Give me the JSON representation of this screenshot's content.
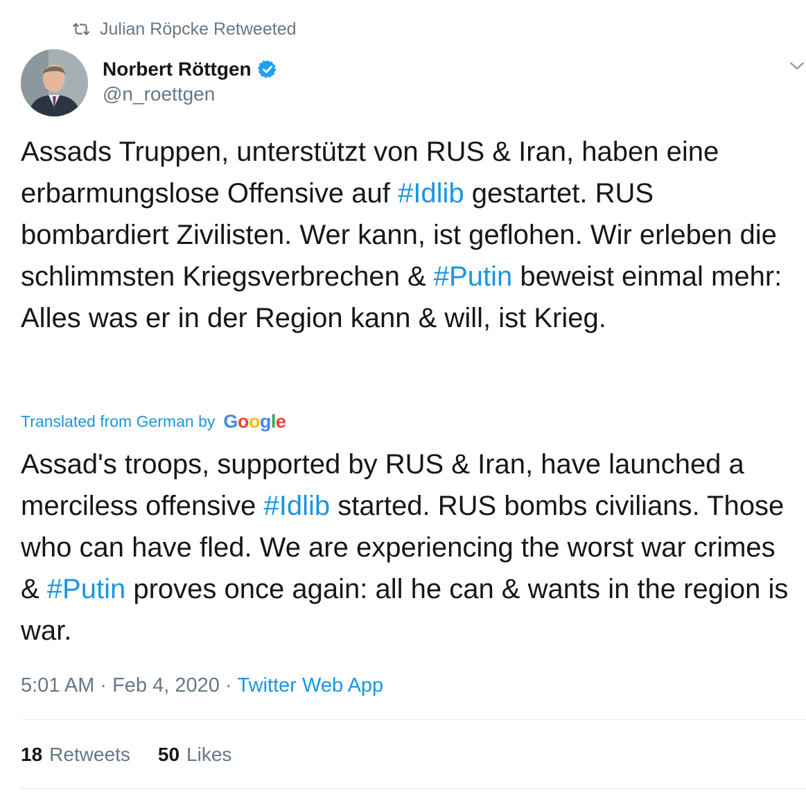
{
  "retweet_context": {
    "icon": "retweet-icon",
    "text": "Julian Röpcke Retweeted"
  },
  "author": {
    "display_name": "Norbert Röttgen",
    "handle": "@n_roettgen",
    "verified": true,
    "verified_icon": "verified-badge-icon"
  },
  "tweet": {
    "segments": [
      {
        "text": "Assads Truppen, unterstützt von RUS & Iran, haben eine erbarmungslose Offensive auf ",
        "hashtag": false
      },
      {
        "text": "#Idlib",
        "hashtag": true
      },
      {
        "text": " gestartet. RUS bombardiert Zivilisten. Wer kann, ist geflohen. Wir erleben die schlimmsten Kriegsverbrechen & ",
        "hashtag": false
      },
      {
        "text": "#Putin",
        "hashtag": true
      },
      {
        "text": " beweist einmal mehr: Alles was er in der Region kann & will, ist Krieg.",
        "hashtag": false
      }
    ]
  },
  "translation": {
    "label": "Translated from German by",
    "provider": "Google",
    "segments": [
      {
        "text": "Assad's troops, supported by RUS & Iran, have launched a merciless offensive ",
        "hashtag": false
      },
      {
        "text": "#Idlib",
        "hashtag": true
      },
      {
        "text": " started. RUS bombs civilians. Those who can have fled. We are experiencing the worst war crimes & ",
        "hashtag": false
      },
      {
        "text": "#Putin",
        "hashtag": true
      },
      {
        "text": " proves once again: all he can & wants in the region is war.",
        "hashtag": false
      }
    ]
  },
  "meta": {
    "time": "5:01 AM",
    "separator": "·",
    "date": "Feb 4, 2020",
    "source": "Twitter Web App"
  },
  "stats": {
    "retweets_count": "18",
    "retweets_label": "Retweets",
    "likes_count": "50",
    "likes_label": "Likes"
  },
  "colors": {
    "link": "#1b95e0",
    "secondary_text": "#657786",
    "primary_text": "#14171a",
    "divider": "#e1e8ed",
    "verified": "#1da1f2"
  }
}
